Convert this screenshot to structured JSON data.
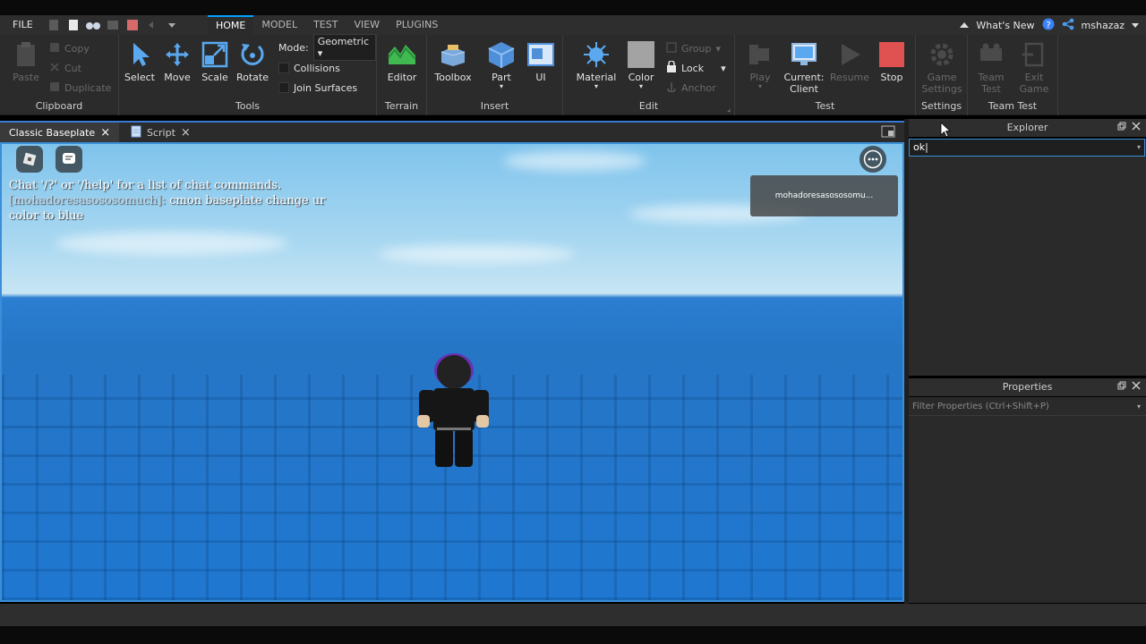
{
  "menubar": {
    "file_label": "FILE",
    "tabs": [
      "HOME",
      "MODEL",
      "TEST",
      "VIEW",
      "PLUGINS"
    ],
    "active_tab": "HOME",
    "whats_new": "What's New",
    "username": "mshazaz"
  },
  "ribbon": {
    "clipboard": {
      "label": "Clipboard",
      "paste": "Paste",
      "copy": "Copy",
      "cut": "Cut",
      "duplicate": "Duplicate"
    },
    "tools": {
      "label": "Tools",
      "select": "Select",
      "move": "Move",
      "scale": "Scale",
      "rotate": "Rotate",
      "mode_label": "Mode:",
      "mode_value": "Geometric",
      "collisions": "Collisions",
      "join_surfaces": "Join Surfaces"
    },
    "terrain": {
      "label": "Terrain",
      "editor": "Editor"
    },
    "insert": {
      "label": "Insert",
      "toolbox": "Toolbox",
      "part": "Part",
      "ui": "UI"
    },
    "edit": {
      "label": "Edit",
      "material": "Material",
      "color": "Color",
      "group": "Group",
      "lock": "Lock",
      "anchor": "Anchor"
    },
    "test": {
      "label": "Test",
      "play": "Play",
      "current_client_1": "Current:",
      "current_client_2": "Client",
      "resume": "Resume",
      "stop": "Stop"
    },
    "settings": {
      "label": "Settings",
      "game_settings_1": "Game",
      "game_settings_2": "Settings"
    },
    "team_test": {
      "label": "Team Test",
      "team_test_1": "Team",
      "team_test_2": "Test",
      "exit_game_1": "Exit",
      "exit_game_2": "Game"
    }
  },
  "doc_tabs": [
    {
      "label": "Classic Baseplate",
      "close": "×"
    },
    {
      "label": "Script",
      "close": "×"
    }
  ],
  "viewport": {
    "chat_help": "Chat '/?' or '/help' for a list of chat commands.",
    "chat_name": "[mohadoresasososomuch]:",
    "chat_message": " cmon baseplate change ur color to blue",
    "player_card": "mohadoresasososomu..."
  },
  "explorer": {
    "title": "Explorer",
    "search_value": "ok"
  },
  "properties": {
    "title": "Properties",
    "filter_placeholder": "Filter Properties (Ctrl+Shift+P)"
  },
  "colors": {
    "accent": "#00a2ff",
    "stop_red": "#e05252",
    "sky": "#a9d8f1",
    "baseplate": "#1f77d0"
  }
}
